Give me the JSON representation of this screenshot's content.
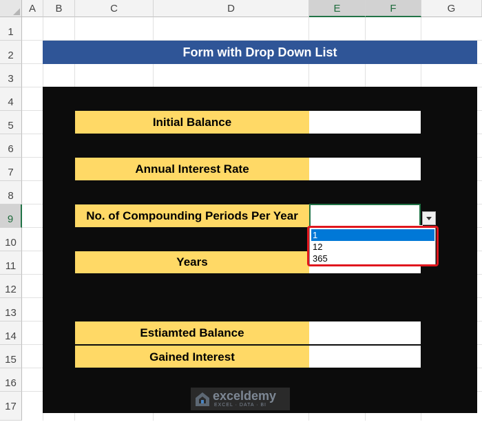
{
  "columns": [
    "A",
    "B",
    "C",
    "D",
    "E",
    "F",
    "G"
  ],
  "rows": [
    "1",
    "2",
    "3",
    "4",
    "5",
    "6",
    "7",
    "8",
    "9",
    "10",
    "11",
    "12",
    "13",
    "14",
    "15",
    "16",
    "17"
  ],
  "form": {
    "title": "Form with Drop Down List",
    "initial_balance_label": "Initial Balance",
    "interest_rate_label": "Annual Interest Rate",
    "periods_label": "No. of Compounding Periods Per Year",
    "years_label": "Years",
    "estimated_balance_label": "Estiamted Balance",
    "gained_interest_label": "Gained Interest",
    "initial_balance_value": "",
    "interest_rate_value": "",
    "periods_value": "",
    "years_value": "",
    "estimated_balance_value": "",
    "gained_interest_value": ""
  },
  "dropdown": {
    "options": [
      "1",
      "12",
      "365"
    ],
    "highlighted_index": 0
  },
  "watermark": {
    "name": "exceldemy",
    "tagline": "EXCEL · DATA · BI"
  },
  "colors": {
    "title_bg": "#2f5597",
    "label_bg": "#ffd966",
    "panel_bg": "#0c0c0c",
    "selection": "#217346",
    "highlight_border": "#e0161d"
  }
}
